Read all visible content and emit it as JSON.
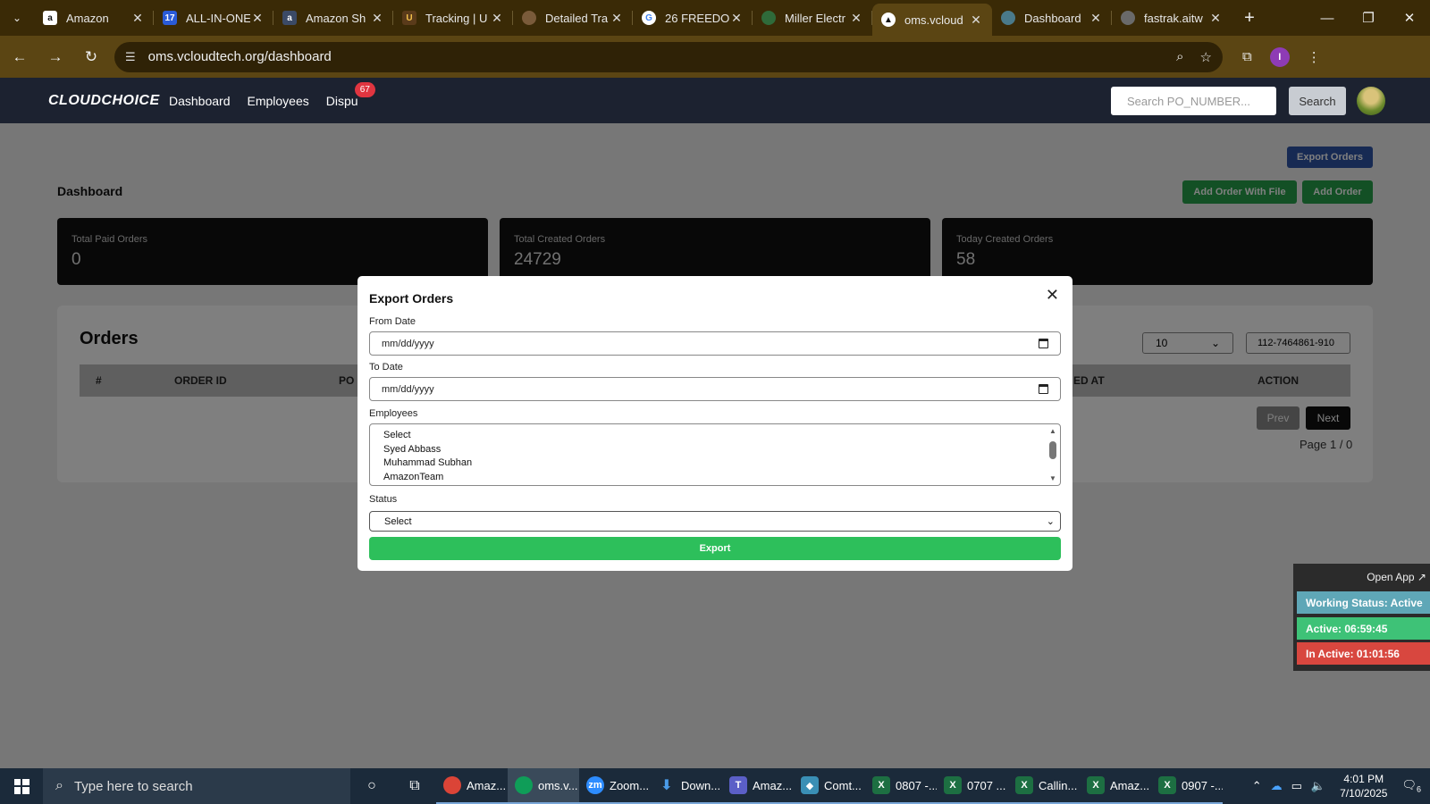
{
  "browser": {
    "tabs": [
      {
        "title": "Amazon",
        "icon": "amazon-icon"
      },
      {
        "title": "ALL-IN-ONE",
        "icon": "17track-icon"
      },
      {
        "title": "Amazon Sh",
        "icon": "amazon-icon"
      },
      {
        "title": "Tracking | U",
        "icon": "ups-icon"
      },
      {
        "title": "Detailed Tra",
        "icon": "tracking-icon"
      },
      {
        "title": "26 FREEDO",
        "icon": "google-icon"
      },
      {
        "title": "Miller Electr",
        "icon": "miller-icon"
      },
      {
        "title": "oms.vcloud",
        "icon": "vercel-icon"
      },
      {
        "title": "Dashboard",
        "icon": "dashboard-icon"
      },
      {
        "title": "fastrak.aitw",
        "icon": "fastrak-icon"
      }
    ],
    "active_tab_index": 7,
    "url": "oms.vcloudtech.org/dashboard",
    "profile_initial": "I"
  },
  "app": {
    "logo": "CLOUDCHOICE",
    "nav": {
      "dashboard": "Dashboard",
      "employees": "Employees",
      "disputes": "Dispu",
      "disputes_badge": "67"
    },
    "search_placeholder": "Search PO_NUMBER...",
    "search_button": "Search"
  },
  "dashboard": {
    "export_orders_button": "Export Orders",
    "title": "Dashboard",
    "add_order_with_file": "Add Order With File",
    "add_order": "Add Order",
    "stats": [
      {
        "label": "Total Paid Orders",
        "value": "0"
      },
      {
        "label": "Total Created Orders",
        "value": "24729"
      },
      {
        "label": "Today Created Orders",
        "value": "58"
      }
    ],
    "orders": {
      "title": "Orders",
      "columns": [
        "#",
        "ORDER ID",
        "PO N",
        "ED AT",
        "ACTION"
      ],
      "per_page": "10",
      "po_filter": "112-7464861-910",
      "prev": "Prev",
      "next": "Next",
      "page_info": "Page 1 / 0"
    }
  },
  "modal": {
    "title": "Export Orders",
    "from_date_label": "From Date",
    "from_date_value": "mm/dd/yyyy",
    "to_date_label": "To Date",
    "to_date_value": "mm/dd/yyyy",
    "employees_label": "Employees",
    "employees_options": [
      "Select",
      "Syed Abbass",
      "Muhammad Subhan",
      "AmazonTeam"
    ],
    "status_label": "Status",
    "status_value": "Select",
    "export_button": "Export"
  },
  "work_widget": {
    "open_app": "Open App ↗",
    "working_status": "Working Status: Active",
    "active": "Active: 06:59:45",
    "inactive": "In Active: 01:01:56"
  },
  "taskbar": {
    "search_placeholder": "Type here to search",
    "apps": [
      {
        "label": "Amaz...",
        "icon": "chrome-icon"
      },
      {
        "label": "oms.v...",
        "icon": "chrome-icon"
      },
      {
        "label": "Zoom...",
        "icon": "zoom-icon"
      },
      {
        "label": "Down...",
        "icon": "download-icon"
      },
      {
        "label": "Amaz...",
        "icon": "teams-icon"
      },
      {
        "label": "Comt...",
        "icon": "comtrex-icon"
      },
      {
        "label": "0807 -...",
        "icon": "excel-icon"
      },
      {
        "label": "0707 ...",
        "icon": "excel-icon"
      },
      {
        "label": "Callin...",
        "icon": "excel-icon"
      },
      {
        "label": "Amaz...",
        "icon": "excel-icon"
      },
      {
        "label": "0907 -...",
        "icon": "excel-icon"
      }
    ],
    "time": "4:01 PM",
    "date": "7/10/2025",
    "notification_count": "6"
  }
}
